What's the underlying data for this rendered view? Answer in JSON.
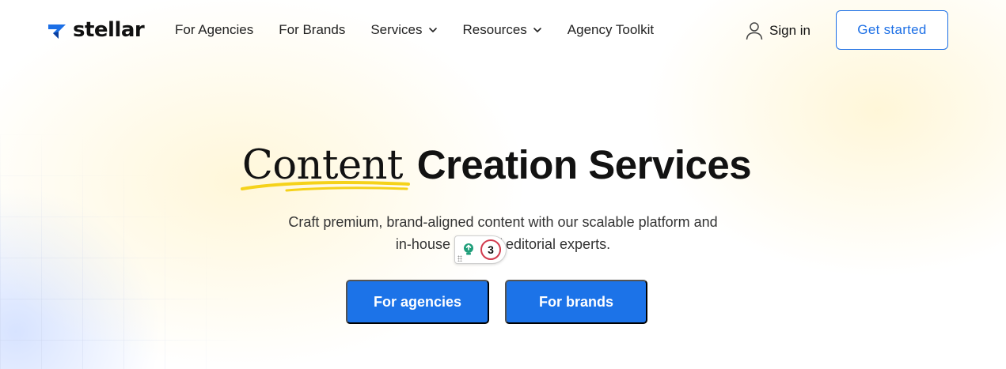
{
  "brand": {
    "name": "stellar",
    "logo_icon": "stellar-logo-mark",
    "logo_color": "#1c6fe6"
  },
  "nav": {
    "items": [
      {
        "label": "For Agencies",
        "has_dropdown": false
      },
      {
        "label": "For Brands",
        "has_dropdown": false
      },
      {
        "label": "Services",
        "has_dropdown": true
      },
      {
        "label": "Resources",
        "has_dropdown": true
      },
      {
        "label": "Agency Toolkit",
        "has_dropdown": false
      }
    ]
  },
  "header_actions": {
    "signin_label": "Sign in",
    "signin_icon": "user-icon",
    "get_started_label": "Get started"
  },
  "hero": {
    "title_accent": "Content",
    "title_rest": "Creation Services",
    "subtitle_line1": "Craft premium, brand-aligned content with our scalable platform and",
    "subtitle_line2": "in-house team of editorial experts.",
    "cta_agencies": "For agencies",
    "cta_brands": "For brands"
  },
  "overlay": {
    "icon": "lightbulb-icon",
    "count": "3",
    "count_ring_color": "#d23b4e"
  },
  "colors": {
    "accent": "#1c6fe6",
    "cta": "#1c73e8",
    "underline": "#f5d21a"
  }
}
